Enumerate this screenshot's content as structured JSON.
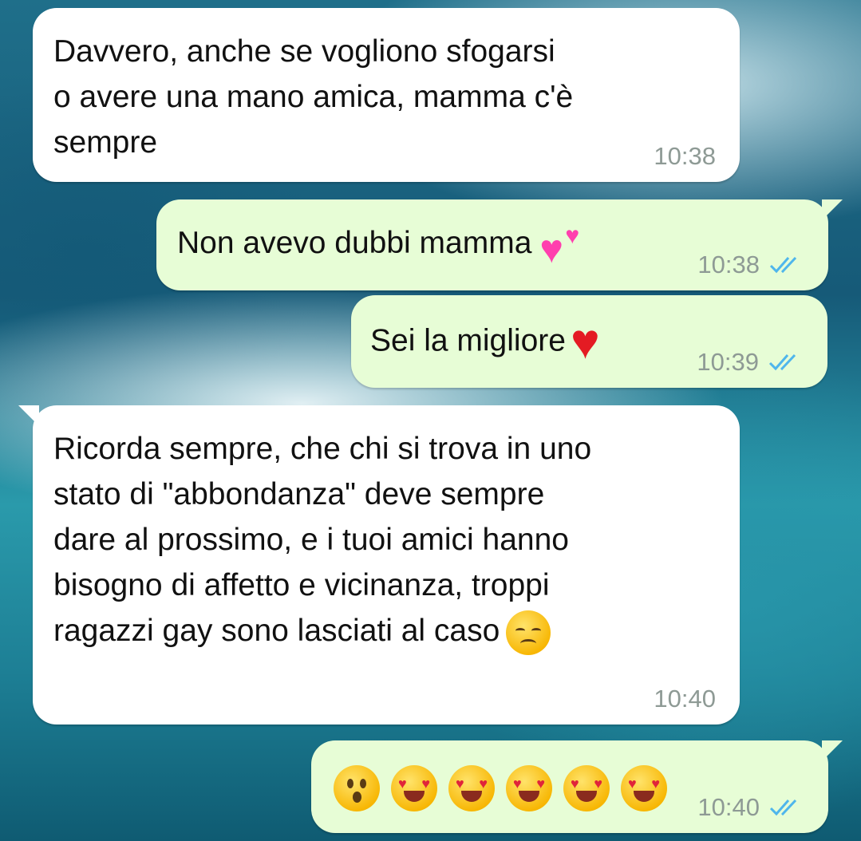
{
  "messages": [
    {
      "direction": "incoming",
      "lines": [
        "Davvero, anche se vogliono sfogarsi",
        "o avere una mano amica, mamma c'è",
        "sempre"
      ],
      "time": "10:38"
    },
    {
      "direction": "outgoing",
      "text": "Non avevo dubbi mamma",
      "emoji": "two-hearts",
      "time": "10:38",
      "status": "read"
    },
    {
      "direction": "outgoing",
      "text": "Sei la migliore",
      "emoji": "red-heart",
      "time": "10:39",
      "status": "read"
    },
    {
      "direction": "incoming",
      "lines": [
        "Ricorda sempre, che chi si trova in uno",
        "stato di \"abbondanza\" deve sempre",
        "dare al prossimo, e i tuoi amici hanno",
        "bisogno di affetto e vicinanza, troppi",
        "ragazzi gay sono lasciati al caso"
      ],
      "emoji": "disappointed-face",
      "time": "10:40"
    },
    {
      "direction": "outgoing",
      "emojis": [
        "hushed-face",
        "heart-eyes-face",
        "heart-eyes-face",
        "heart-eyes-face",
        "heart-eyes-face",
        "heart-eyes-face"
      ],
      "time": "10:40",
      "status": "read"
    }
  ],
  "colors": {
    "incoming_bubble": "#ffffff",
    "outgoing_bubble": "#e7fdd6",
    "read_ticks": "#4fb6ec",
    "timestamp": "#8e9a95"
  }
}
